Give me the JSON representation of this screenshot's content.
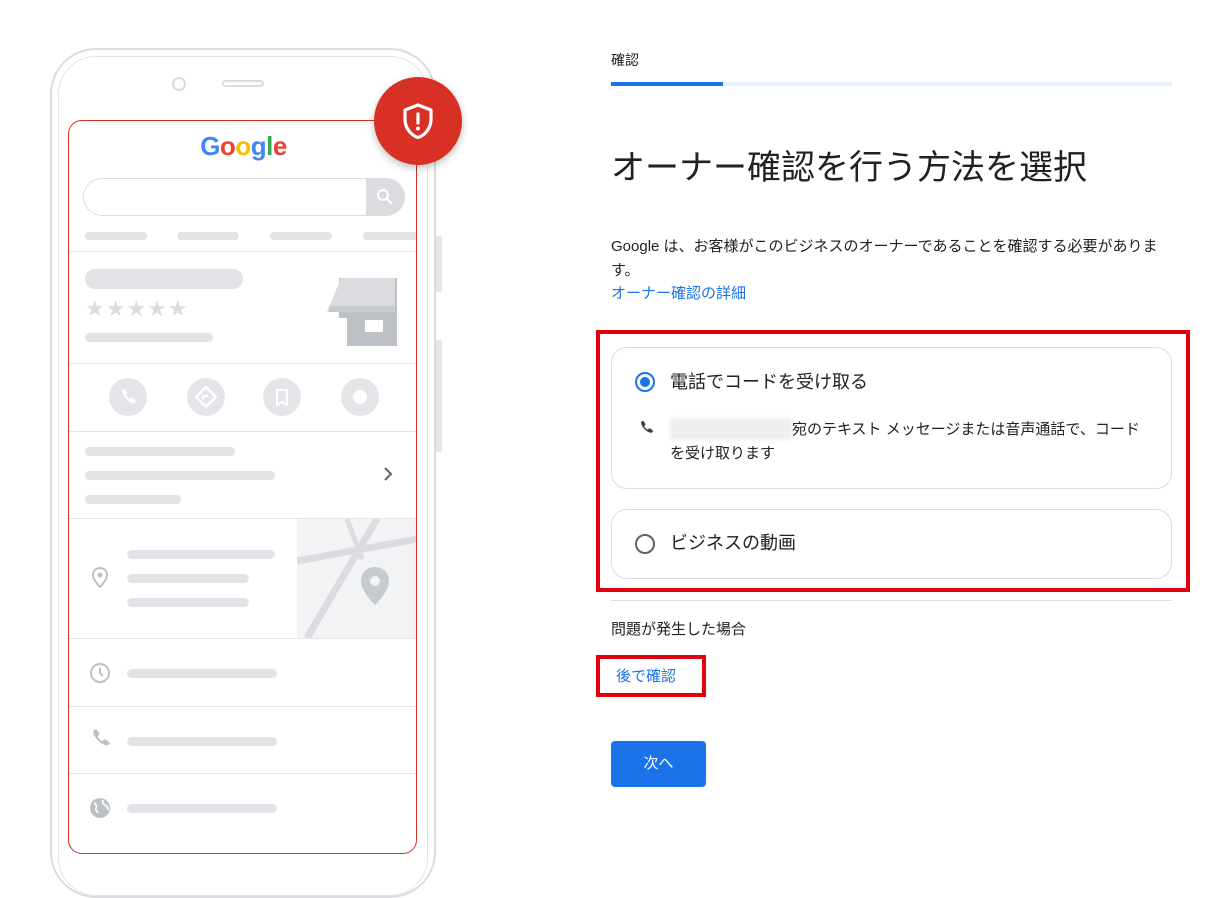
{
  "step_label": "確認",
  "progress": 0.2,
  "heading": "オーナー確認を行う方法を選択",
  "description": "Google は、お客様がこのビジネスのオーナーであることを確認する必要があります。",
  "learn_more_link": "オーナー確認の詳細",
  "options": [
    {
      "label": "電話でコードを受け取る",
      "selected": true,
      "detail_suffix": "宛のテキスト メッセージまたは音声通話で、コードを受け取ります",
      "icon": "phone-icon"
    },
    {
      "label": "ビジネスの動画",
      "selected": false
    }
  ],
  "trouble_label": "問題が発生した場合",
  "verify_later_link": "後で確認",
  "next_button": "次へ",
  "phone_mock": {
    "logo": "Google",
    "stars": "★★★★★",
    "search_icon": "search-icon",
    "shield_icon": "shield-alert-icon"
  },
  "colors": {
    "accent": "#1a73e8",
    "alert_red": "#d93025",
    "highlight_red": "#e0000f"
  }
}
